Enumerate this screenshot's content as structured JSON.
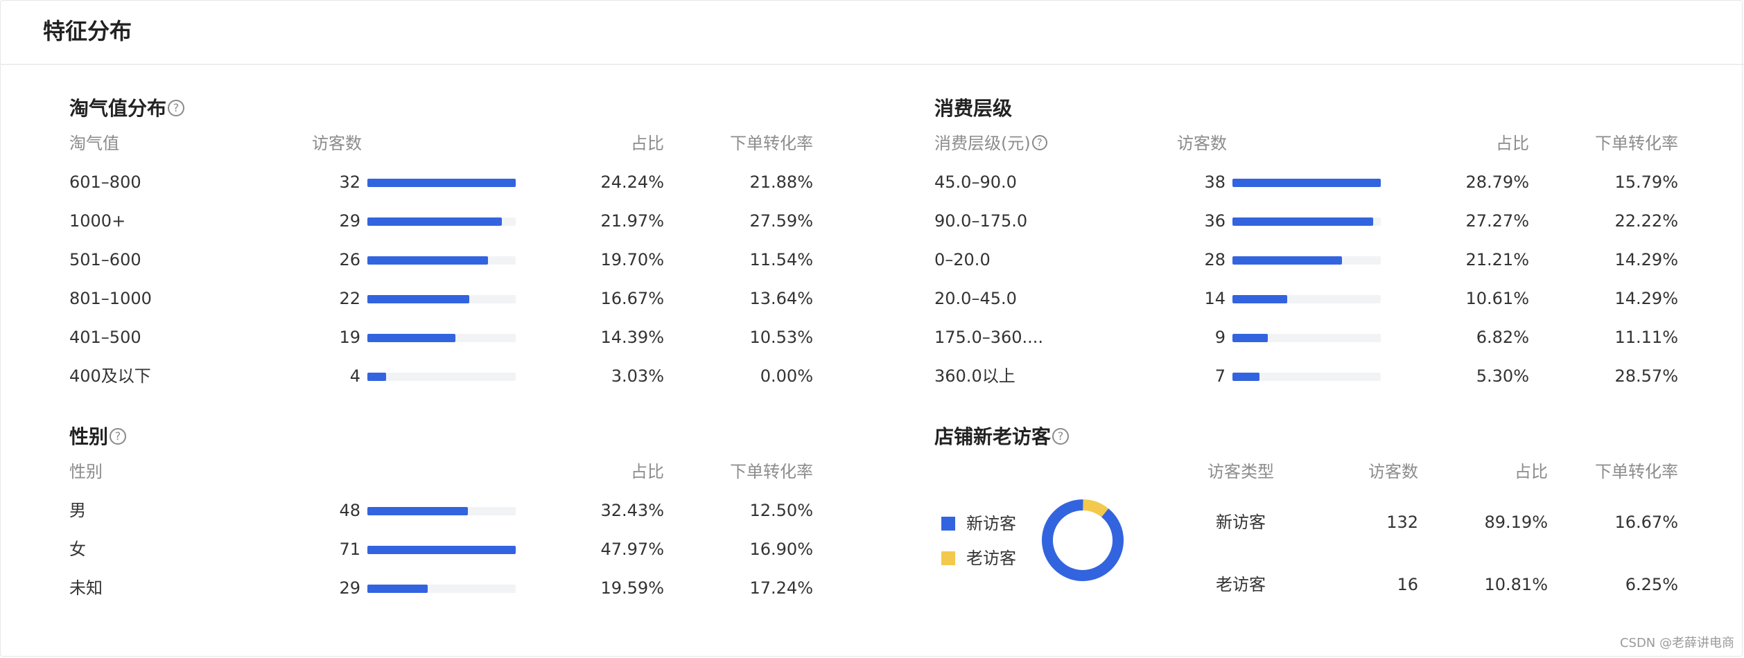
{
  "page_title": "特征分布",
  "taoqi": {
    "title": "淘气值分布",
    "headers": {
      "c1": "淘气值",
      "c2": "访客数",
      "c3": "占比",
      "c4": "下单转化率"
    },
    "rows": [
      {
        "label": "601–800",
        "visitors": "32",
        "share": "24.24%",
        "conv": "21.88%",
        "bar": 1.0
      },
      {
        "label": "1000+",
        "visitors": "29",
        "share": "21.97%",
        "conv": "27.59%",
        "bar": 0.906
      },
      {
        "label": "501–600",
        "visitors": "26",
        "share": "19.70%",
        "conv": "11.54%",
        "bar": 0.8125
      },
      {
        "label": "801–1000",
        "visitors": "22",
        "share": "16.67%",
        "conv": "13.64%",
        "bar": 0.6875
      },
      {
        "label": "401–500",
        "visitors": "19",
        "share": "14.39%",
        "conv": "10.53%",
        "bar": 0.594
      },
      {
        "label": "400及以下",
        "visitors": "4",
        "share": "3.03%",
        "conv": "0.00%",
        "bar": 0.125
      }
    ]
  },
  "spend": {
    "title": "消费层级",
    "headers": {
      "c1": "消费层级(元)",
      "c2": "访客数",
      "c3": "占比",
      "c4": "下单转化率"
    },
    "rows": [
      {
        "label": "45.0–90.0",
        "visitors": "38",
        "share": "28.79%",
        "conv": "15.79%",
        "bar": 1.0
      },
      {
        "label": "90.0–175.0",
        "visitors": "36",
        "share": "27.27%",
        "conv": "22.22%",
        "bar": 0.947
      },
      {
        "label": "0–20.0",
        "visitors": "28",
        "share": "21.21%",
        "conv": "14.29%",
        "bar": 0.737
      },
      {
        "label": "20.0–45.0",
        "visitors": "14",
        "share": "10.61%",
        "conv": "14.29%",
        "bar": 0.368
      },
      {
        "label": "175.0–360....",
        "visitors": "9",
        "share": "6.82%",
        "conv": "11.11%",
        "bar": 0.237
      },
      {
        "label": "360.0以上",
        "visitors": "7",
        "share": "5.30%",
        "conv": "28.57%",
        "bar": 0.184
      }
    ]
  },
  "gender": {
    "title": "性别",
    "headers": {
      "c1": "性别",
      "c3": "占比",
      "c4": "下单转化率"
    },
    "rows": [
      {
        "label": "男",
        "visitors": "48",
        "share": "32.43%",
        "conv": "12.50%",
        "bar": 0.676
      },
      {
        "label": "女",
        "visitors": "71",
        "share": "47.97%",
        "conv": "16.90%",
        "bar": 1.0
      },
      {
        "label": "未知",
        "visitors": "29",
        "share": "19.59%",
        "conv": "17.24%",
        "bar": 0.408
      }
    ]
  },
  "visitor_type": {
    "title": "店铺新老访客",
    "headers": {
      "c1": "访客类型",
      "c2": "访客数",
      "c3": "占比",
      "c4": "下单转化率"
    },
    "legend": [
      {
        "label": "新访客",
        "color": "#3364df"
      },
      {
        "label": "老访客",
        "color": "#f2c94c"
      }
    ],
    "rows": [
      {
        "label": "新访客",
        "visitors": "132",
        "share": "89.19%",
        "conv": "16.67%"
      },
      {
        "label": "老访客",
        "visitors": "16",
        "share": "10.81%",
        "conv": "6.25%"
      }
    ],
    "donut": {
      "new_fraction": 0.8919,
      "old_fraction": 0.1081
    }
  },
  "watermark": "CSDN @老薛讲电商",
  "colors": {
    "accent": "#3364df",
    "secondary": "#f2c94c",
    "track": "#f2f3f5"
  }
}
